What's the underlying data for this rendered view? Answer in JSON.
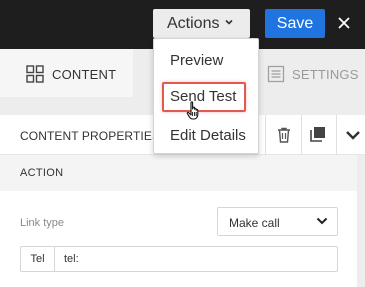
{
  "topbar": {
    "actions_label": "Actions",
    "save_label": "Save",
    "colors": {
      "background": "#1e1e1e",
      "save": "#1f74e0"
    }
  },
  "tabs": {
    "content_label": "CONTENT",
    "settings_label": "SETTINGS"
  },
  "actions_menu": {
    "items": [
      {
        "label": "Preview"
      },
      {
        "label": "Send Test",
        "highlighted": true
      },
      {
        "label": "Edit Details"
      }
    ],
    "highlight_color": "#e05a4f"
  },
  "properties": {
    "title": "CONTENT PROPERTIES",
    "section_title": "ACTION",
    "link_type_label": "Link type",
    "link_type_value": "Make call",
    "tel_addon": "Tel",
    "tel_value": "tel:"
  }
}
